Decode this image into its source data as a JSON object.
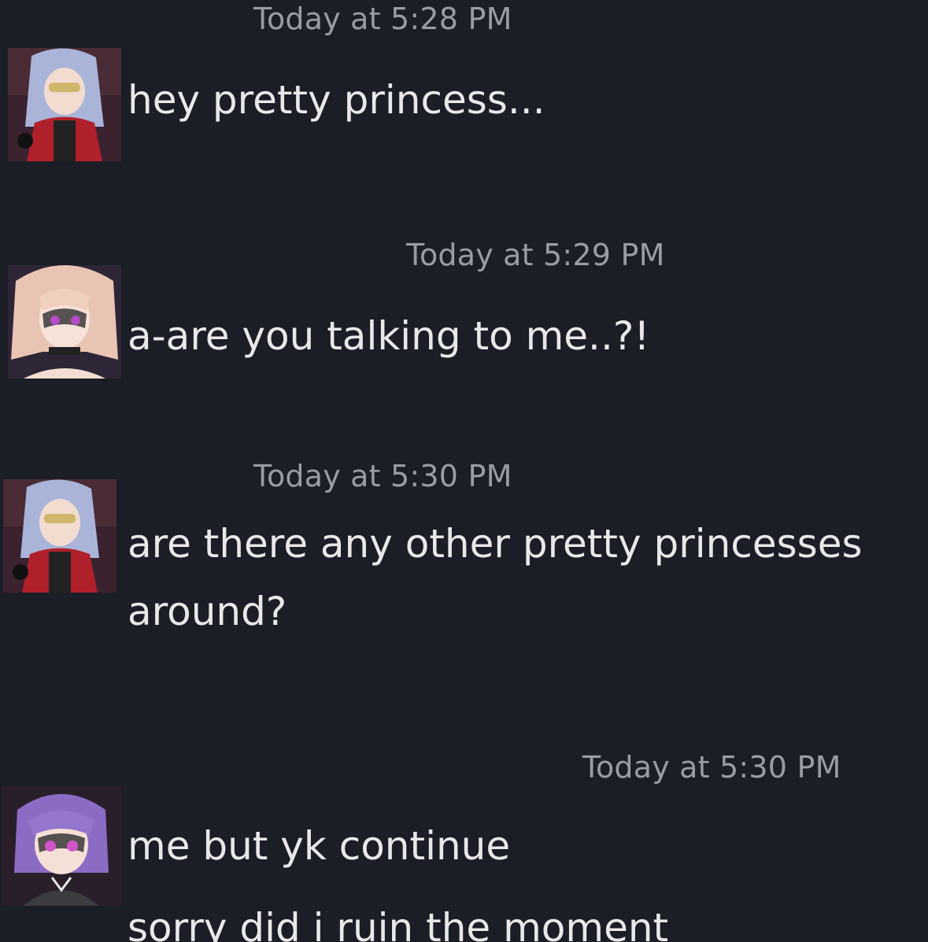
{
  "messages": [
    {
      "timestamp": "Today at 5:28 PM",
      "avatar": "avatar-silver-hair-glasses-red-dress",
      "lines": [
        "hey pretty princess..."
      ]
    },
    {
      "timestamp": "Today at 5:29 PM",
      "avatar": "avatar-blonde-lace-mask",
      "lines": [
        "a-are you talking to me..?!"
      ]
    },
    {
      "timestamp": "Today at 5:30 PM",
      "avatar": "avatar-silver-hair-glasses-red-dress",
      "lines": [
        "are there any other pretty princesses",
        "around?"
      ]
    },
    {
      "timestamp": "Today at 5:30 PM",
      "avatar": "avatar-purple-hair-lace-mask",
      "lines": [
        "me but yk continue",
        "sorry did i ruin the moment"
      ]
    }
  ],
  "colors": {
    "background": "#1b1d27",
    "timestamp": "#9a9ca3",
    "message_text": "#e8e8ea"
  }
}
